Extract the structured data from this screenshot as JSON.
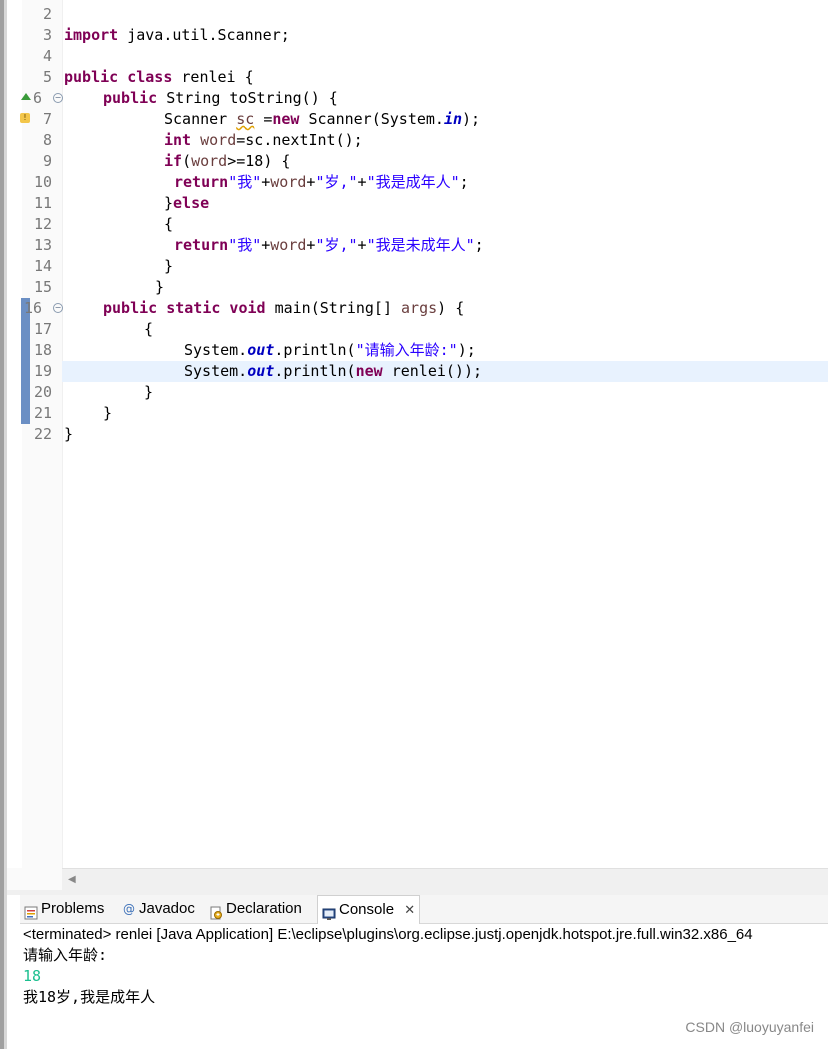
{
  "editor": {
    "lines": [
      {
        "n": "2"
      },
      {
        "n": "3"
      },
      {
        "n": "4"
      },
      {
        "n": "5"
      },
      {
        "n": "6"
      },
      {
        "n": "7"
      },
      {
        "n": "8"
      },
      {
        "n": "9"
      },
      {
        "n": "10"
      },
      {
        "n": "11"
      },
      {
        "n": "12"
      },
      {
        "n": "13"
      },
      {
        "n": "14"
      },
      {
        "n": "15"
      },
      {
        "n": "16"
      },
      {
        "n": "17"
      },
      {
        "n": "18"
      },
      {
        "n": "19"
      },
      {
        "n": "20"
      },
      {
        "n": "21"
      },
      {
        "n": "22"
      }
    ],
    "code": {
      "l3_kw": "import",
      "l3_rest": " java.util.Scanner;",
      "l5_kw": "public class",
      "l5_rest": " renlei {",
      "l6_kw": "public",
      "l6_rest": " String toString() {",
      "l7_a": "Scanner ",
      "l7_var": "sc",
      "l7_b": " =",
      "l7_kw": "new",
      "l7_c": " Scanner(System.",
      "l7_fld": "in",
      "l7_d": ");",
      "l8_kw": "int",
      "l8_var": " word",
      "l8_rest": "=sc.nextInt();",
      "l9_kw": "if",
      "l9_a": "(",
      "l9_var": "word",
      "l9_b": ">=18) {",
      "l10_kw": "return",
      "l10_s1": "\"我\"",
      "l10_a": "+",
      "l10_var": "word",
      "l10_b": "+",
      "l10_s2": "\"岁,\"",
      "l10_c": "+",
      "l10_s3": "\"我是成年人\"",
      "l10_d": ";",
      "l11_a": "}",
      "l11_kw": "else",
      "l12": "{",
      "l13_kw": "return",
      "l13_s1": "\"我\"",
      "l13_a": "+",
      "l13_var": "word",
      "l13_b": "+",
      "l13_s2": "\"岁,\"",
      "l13_c": "+",
      "l13_s3": "\"我是未成年人\"",
      "l13_d": ";",
      "l14": "}",
      "l15": "}",
      "l16_kw": "public static void",
      "l16_a": " main(String[] ",
      "l16_var": "args",
      "l16_b": ") {",
      "l17": "{",
      "l18_a": "System.",
      "l18_fld": "out",
      "l18_b": ".println(",
      "l18_s": "\"请输入年龄:\"",
      "l18_c": ");",
      "l19_a": "System.",
      "l19_fld": "out",
      "l19_b": ".println(",
      "l19_kw": "new",
      "l19_c": " renlei());",
      "l20": "}",
      "l21": "}",
      "l22": "}"
    }
  },
  "tabs": [
    {
      "label": "Problems",
      "icon": "problems-icon"
    },
    {
      "label": "Javadoc",
      "icon": "javadoc-icon"
    },
    {
      "label": "Declaration",
      "icon": "declaration-icon"
    },
    {
      "label": "Console",
      "icon": "console-icon",
      "close": "✕"
    }
  ],
  "console": {
    "header": "<terminated> renlei [Java Application] E:\\eclipse\\plugins\\org.eclipse.justj.openjdk.hotspot.jre.full.win32.x86_64",
    "out1": "请输入年龄:",
    "in1": "18",
    "out2": "我18岁,我是成年人"
  },
  "watermark": "CSDN @luoyuyanfei",
  "colors": {
    "keyword": "#7f0055",
    "string": "#2a00ff",
    "variable": "#6a3e3e",
    "field": "#0000c0",
    "console_input": "#1bbf8f"
  }
}
